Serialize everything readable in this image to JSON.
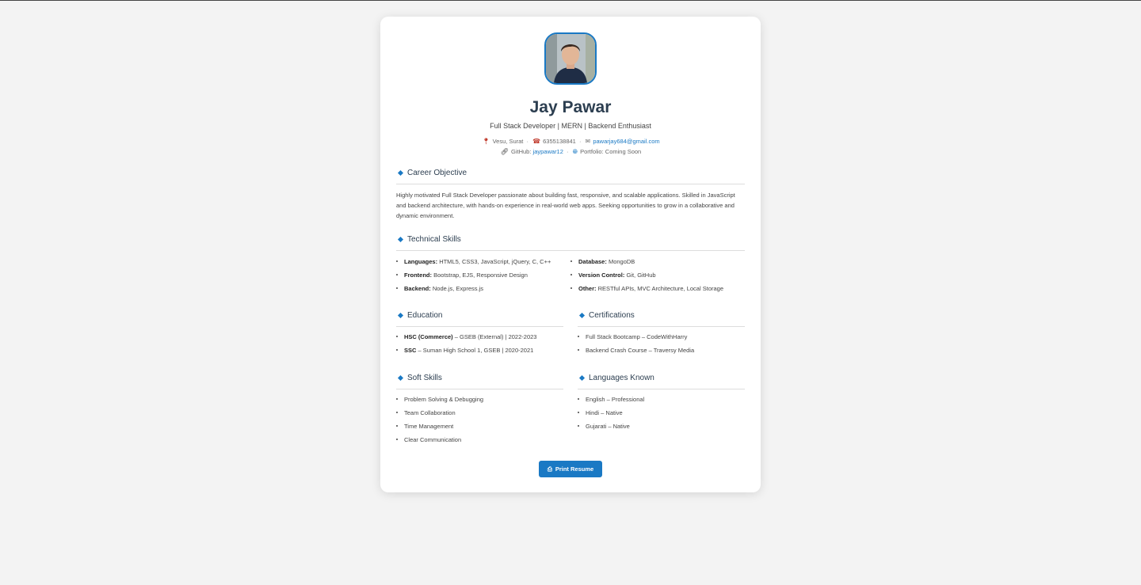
{
  "profile": {
    "name": "Jay Pawar",
    "tagline": "Full Stack Developer | MERN | Backend Enthusiast",
    "location": "Vesu, Surat",
    "phone": "6355138841",
    "email": "pawarjay684@gmail.com",
    "github_label": "GitHub:",
    "github": "jaypawar12",
    "portfolio": "Portfolio: Coming Soon"
  },
  "icons": {
    "location": "map-pin-icon",
    "phone": "phone-icon",
    "email": "envelope-icon",
    "github": "link-icon",
    "portfolio": "globe-icon",
    "print": "printer-icon"
  },
  "colors": {
    "accent": "#1a79c4",
    "heading": "#2c3e50"
  },
  "objective": {
    "title": "Career Objective",
    "text": "Highly motivated Full Stack Developer passionate about building fast, responsive, and scalable applications. Skilled in JavaScript and backend architecture, with hands-on experience in real-world web apps. Seeking opportunities to grow in a collaborative and dynamic environment."
  },
  "skills": {
    "title": "Technical Skills",
    "left": [
      {
        "label": "Languages:",
        "value": "HTML5, CSS3, JavaScript, jQuery, C, C++"
      },
      {
        "label": "Frontend:",
        "value": "Bootstrap, EJS, Responsive Design"
      },
      {
        "label": "Backend:",
        "value": "Node.js, Express.js"
      }
    ],
    "right": [
      {
        "label": "Database:",
        "value": "MongoDB"
      },
      {
        "label": "Version Control:",
        "value": "Git, GitHub"
      },
      {
        "label": "Other:",
        "value": "RESTful APIs, MVC Architecture, Local Storage"
      }
    ]
  },
  "education": {
    "title": "Education",
    "items": [
      {
        "label": "HSC (Commerce)",
        "value": "– GSEB (External) | 2022-2023"
      },
      {
        "label": "SSC",
        "value": "– Suman High School 1, GSEB | 2020-2021"
      }
    ]
  },
  "certifications": {
    "title": "Certifications",
    "items": [
      "Full Stack Bootcamp – CodeWithHarry",
      "Backend Crash Course – Traversy Media"
    ]
  },
  "soft_skills": {
    "title": "Soft Skills",
    "items": [
      "Problem Solving & Debugging",
      "Team Collaboration",
      "Time Management",
      "Clear Communication"
    ]
  },
  "languages": {
    "title": "Languages Known",
    "items": [
      "English – Professional",
      "Hindi – Native",
      "Gujarati – Native"
    ]
  },
  "actions": {
    "print_label": "Print Resume"
  }
}
